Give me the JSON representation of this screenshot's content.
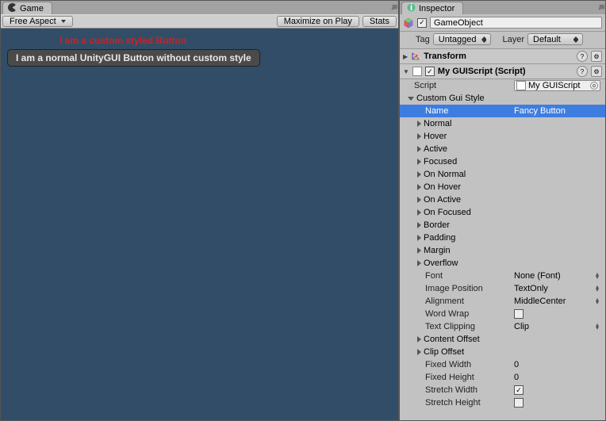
{
  "game": {
    "tab_label": "Game",
    "aspect": "Free Aspect",
    "maximize": "Maximize on Play",
    "stats": "Stats",
    "custom_button_text": "I am a custom styled Button",
    "normal_button_text": "I am a normal UnityGUI Button without custom style"
  },
  "inspector": {
    "tab_label": "Inspector",
    "object_name": "GameObject",
    "tag_label": "Tag",
    "tag_value": "Untagged",
    "layer_label": "Layer",
    "layer_value": "Default",
    "transform_label": "Transform",
    "script_component_label": "My GUIScript (Script)",
    "script_label": "Script",
    "script_value": "My GUIScript",
    "custom_style_label": "Custom Gui Style",
    "name_label": "Name",
    "name_value": "Fancy Button",
    "states": [
      "Normal",
      "Hover",
      "Active",
      "Focused",
      "On Normal",
      "On Hover",
      "On Active",
      "On Focused",
      "Border",
      "Padding",
      "Margin",
      "Overflow"
    ],
    "font_label": "Font",
    "font_value": "None (Font)",
    "image_pos_label": "Image Position",
    "image_pos_value": "TextOnly",
    "alignment_label": "Alignment",
    "alignment_value": "MiddleCenter",
    "wordwrap_label": "Word Wrap",
    "textclip_label": "Text Clipping",
    "textclip_value": "Clip",
    "content_offset_label": "Content Offset",
    "clip_offset_label": "Clip Offset",
    "fixed_width_label": "Fixed Width",
    "fixed_width_value": "0",
    "fixed_height_label": "Fixed Height",
    "fixed_height_value": "0",
    "stretch_width_label": "Stretch Width",
    "stretch_height_label": "Stretch Height"
  }
}
